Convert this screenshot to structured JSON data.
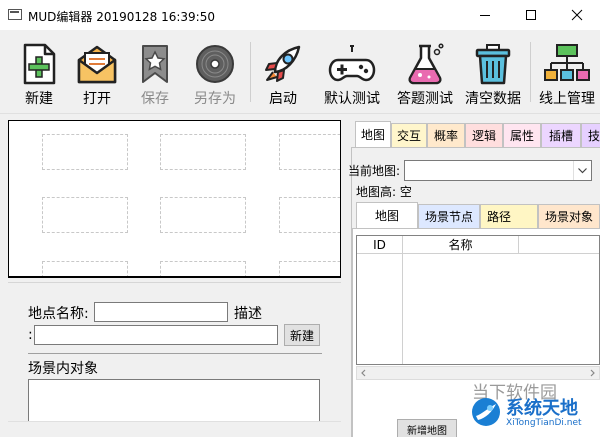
{
  "window": {
    "title": "MUD编辑器 20190128 16:39:50",
    "buttons": [
      "minimize",
      "maximize",
      "close"
    ]
  },
  "toolbar": {
    "items": [
      {
        "label": "新建",
        "icon": "new-file-icon",
        "enabled": true
      },
      {
        "label": "打开",
        "icon": "open-envelope-icon",
        "enabled": true
      },
      {
        "label": "保存",
        "icon": "save-star-icon",
        "enabled": false
      },
      {
        "label": "另存为",
        "icon": "disc-icon",
        "enabled": false
      },
      {
        "label": "启动",
        "icon": "rocket-icon",
        "enabled": true
      },
      {
        "label": "默认测试",
        "icon": "gamepad-icon",
        "enabled": true
      },
      {
        "label": "答题测试",
        "icon": "flask-icon",
        "enabled": true
      },
      {
        "label": "清空数据",
        "icon": "trash-icon",
        "enabled": true
      },
      {
        "label": "线上管理",
        "icon": "hierarchy-icon",
        "enabled": true
      }
    ]
  },
  "location": {
    "name_label": "地点名称:",
    "desc_label": "描述",
    "colon": ":",
    "new_button": "新建",
    "objects_label": "场景内对象"
  },
  "right": {
    "tabs": [
      "地图",
      "交互",
      "概率",
      "逻辑",
      "属性",
      "插槽",
      "技"
    ],
    "current_map_label": "当前地图:",
    "map_height_label": "地图高: 空",
    "subtabs": [
      "地图",
      "场景节点",
      "路径",
      "场景对象"
    ],
    "grid_headers": [
      "ID",
      "名称"
    ],
    "bottom_button": "新增地图"
  },
  "colors": {
    "tab_jiaohu": "#fff6cc",
    "tab_gailv": "#ffe9cc",
    "tab_luoji": "#ffdede",
    "tab_shuxing": "#ffe5f0",
    "tab_chacao": "#ecd6ff",
    "tab_ji": "#e6d0ff",
    "sub_changjingjiedian": "#dde8ff",
    "sub_lujing": "#fff6c4",
    "sub_changjingduixiang": "#ffe6cc"
  },
  "watermark": {
    "top": "当下软件园",
    "brand": "系统天地",
    "url": "XiTongTianDi.net"
  }
}
